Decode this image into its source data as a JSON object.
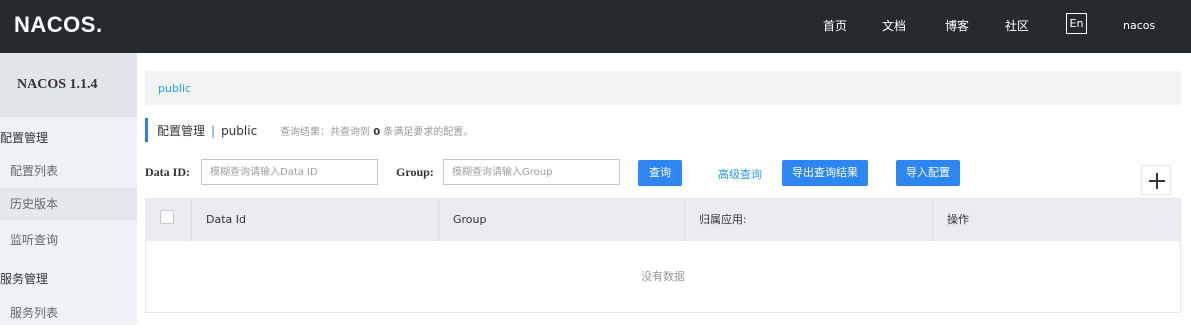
{
  "topbar": {
    "logo": "NACOS.",
    "nav": [
      "首页",
      "文档",
      "博客",
      "社区"
    ],
    "lang": "En",
    "user": "nacos"
  },
  "sidebar": {
    "version": "NACOS 1.1.4",
    "groups": [
      {
        "label": "配置管理",
        "items": [
          "配置列表",
          "历史版本",
          "监听查询"
        ]
      },
      {
        "label": "服务管理",
        "items": [
          "服务列表"
        ]
      }
    ]
  },
  "breadcrumb": {
    "namespace": "public"
  },
  "page": {
    "title": "配置管理",
    "separator": "|",
    "namespace": "public",
    "query_result_prefix": "查询结果：共查询到",
    "query_result_count": "0",
    "query_result_suffix": "条满足要求的配置。"
  },
  "filters": {
    "data_id_label": "Data ID:",
    "data_id_placeholder": "模糊查询请输入Data ID",
    "group_label": "Group:",
    "group_placeholder": "模糊查询请输入Group",
    "search_button": "查询",
    "advanced_link": "高级查询",
    "export_button": "导出查询结果",
    "import_button": "导入配置"
  },
  "table": {
    "columns": [
      "Data Id",
      "Group",
      "归属应用:",
      "操作"
    ],
    "empty_text": "没有数据"
  },
  "colors": {
    "topbar_bg": "#252a2f",
    "primary": "#2d86f2",
    "link": "#2a9be0"
  }
}
